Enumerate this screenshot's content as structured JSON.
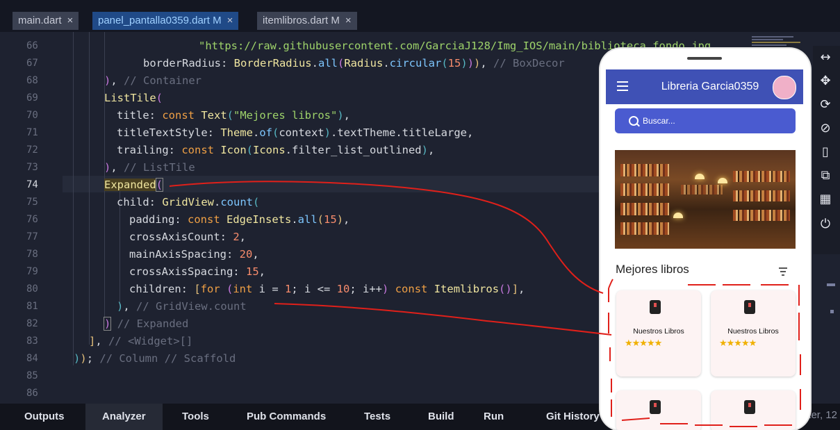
{
  "tabs": [
    {
      "label": "main.dart",
      "close": "×",
      "active": false
    },
    {
      "label": "panel_pantalla0359.dart M",
      "close": "×",
      "active": true
    },
    {
      "label": "itemlibros.dart M",
      "close": "×",
      "active": false
    }
  ],
  "editor": {
    "current_line": "74",
    "line_numbers": [
      "66",
      "67",
      "68",
      "69",
      "70",
      "71",
      "72",
      "73",
      "74",
      "75",
      "76",
      "77",
      "78",
      "79",
      "80",
      "81",
      "82",
      "83",
      "84",
      "85",
      "86"
    ]
  },
  "bottom_tabs": [
    "Outputs",
    "Analyzer",
    "Tools",
    "Pub Commands",
    "Tests",
    "Build",
    "Run",
    "Git History"
  ],
  "status_text": "ter, 12",
  "app": {
    "title": "Libreria Garcia0359",
    "search_placeholder": "Buscar...",
    "section_title": "Mejores libros",
    "cards": [
      {
        "title": "Nuestros Libros",
        "rating": "★★★★★"
      },
      {
        "title": "Nuestros Libros",
        "rating": "★★★★★"
      },
      {
        "title": "",
        "rating": ""
      },
      {
        "title": "",
        "rating": ""
      }
    ]
  },
  "sidebar_icons": [
    "expand-horizontal-icon",
    "move-icon",
    "rotate-icon",
    "rotate-device-icon",
    "resize-icon",
    "open-external-icon",
    "qr-code-icon",
    "power-icon"
  ],
  "colors": {
    "appbar": "#3f51b5",
    "search": "#4a5bd0",
    "active_tab": "#204a87",
    "annotation": "#e0201a"
  }
}
